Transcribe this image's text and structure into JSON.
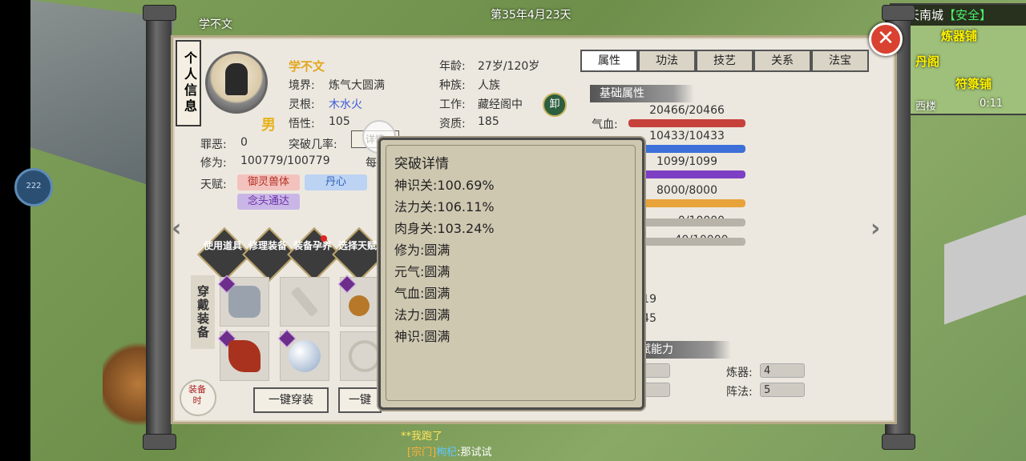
{
  "hud": {
    "date": "第35年4月23天",
    "top_name": "学不文",
    "location": "天南城",
    "safety": "【安全】",
    "minimap_shops": [
      "炼器铺",
      "丹阁",
      "符箓铺",
      "西楼"
    ],
    "minimap_time": "0:11",
    "side_badge": "222"
  },
  "panel": {
    "vertical_title": "个人信息",
    "tabs": [
      "属性",
      "功法",
      "技艺",
      "关系",
      "法宝"
    ],
    "active_tab": "属性"
  },
  "profile": {
    "name": "学不文",
    "gender": "男",
    "realm_label": "境界:",
    "realm": "炼气大圆满",
    "root_label": "灵根:",
    "root": "木水火",
    "insight_label": "悟性:",
    "insight": "105",
    "age_label": "年龄:",
    "age": "27岁/120岁",
    "race_label": "种族:",
    "race": "人族",
    "job_label": "工作:",
    "job": "藏经阁中",
    "aptitude_label": "资质:",
    "aptitude": "185",
    "sin_label": "罪恶:",
    "sin": "0",
    "breakthrough_label": "突破几率:",
    "breakthrough_btn": "详情",
    "cultivation_label": "修为:",
    "cultivation": "100779/100779",
    "per_label": "每",
    "talent_label": "天赋:",
    "talents": [
      "御灵兽体",
      "丹心",
      "念头通达"
    ],
    "unequip_icon": "卸"
  },
  "actions": [
    {
      "label": "使用道具",
      "dot": false
    },
    {
      "label": "修理装备",
      "dot": false
    },
    {
      "label": "装备孕养",
      "dot": true
    },
    {
      "label": "选择天赋",
      "dot": false
    }
  ],
  "equipment": {
    "title": "穿戴装备",
    "equip_all": "一键穿装",
    "unequip_all": "一键",
    "slots": [
      {
        "icon": "armor-icon",
        "color": "#9aa3ad",
        "quality": true
      },
      {
        "icon": "sword-icon",
        "color": "#c8c4bb",
        "quality": false
      },
      {
        "icon": "amulet-icon",
        "color": "#b8782a",
        "quality": true
      },
      {
        "icon": "boots-icon",
        "color": "#a8321e",
        "quality": true
      },
      {
        "icon": "orb-icon",
        "color": "#c8d6e6",
        "quality": true
      },
      {
        "icon": "ring-icon",
        "color": "#d8d4cc",
        "quality": false
      }
    ],
    "corner_label": "装备时"
  },
  "attributes": {
    "section_title": "基础属性",
    "bars": [
      {
        "label": "气血:",
        "value": "20466/20466",
        "fill": 1.0,
        "color": "#c7413b"
      },
      {
        "label": "",
        "value": "10433/10433",
        "fill": 1.0,
        "color": "#3c6fd8"
      },
      {
        "label": "",
        "value": "1099/1099",
        "fill": 1.0,
        "color": "#7d3fc4"
      },
      {
        "label": "",
        "value": "8000/8000",
        "fill": 1.0,
        "color": "#e8a33a"
      },
      {
        "label": "",
        "value": "0/10000",
        "fill": 0.0,
        "color": "#888888"
      },
      {
        "label": "",
        "value": "40/10000",
        "fill": 0.004,
        "color": "#888888"
      }
    ],
    "partial_values": [
      ": 19",
      ": 45"
    ],
    "section2_title": "赋能力",
    "skills": [
      {
        "label": "炼器:",
        "value": "4"
      },
      {
        "label": "阵法:",
        "value": "5"
      }
    ]
  },
  "popup": {
    "title": "突破详情",
    "lines": [
      "神识关:100.69%",
      "法力关:106.11%",
      "肉身关:103.24%",
      "修为:圆满",
      "元气:圆满",
      "气血:圆满",
      "法力:圆满",
      "神识:圆满"
    ]
  },
  "chat": {
    "line1": "**我跑了",
    "line2_sect": "[宗门]",
    "line2_who": "枸杞",
    "line2_msg": ":那试试"
  }
}
